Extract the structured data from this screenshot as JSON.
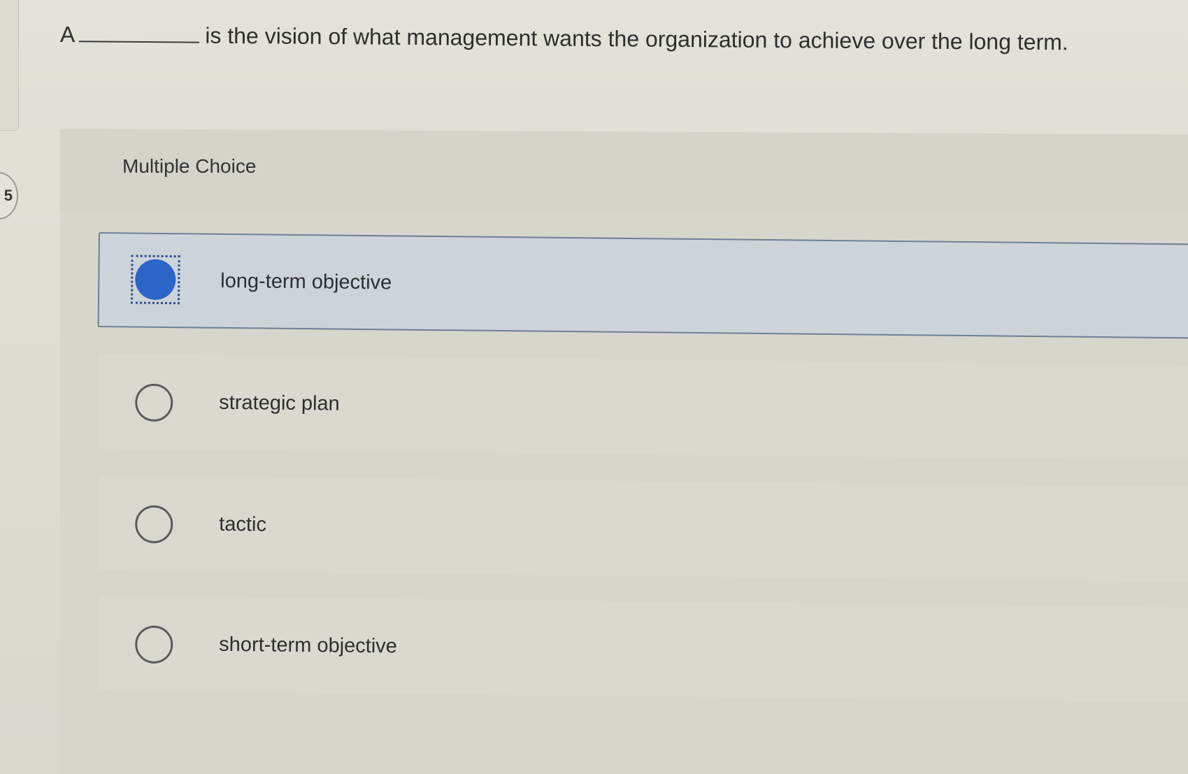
{
  "question": {
    "number": "5",
    "prefix": "A",
    "suffix": "is the vision of what management wants the organization to achieve over the long term."
  },
  "section_label": "Multiple Choice",
  "choices": [
    {
      "label": "long-term objective",
      "selected": true
    },
    {
      "label": "strategic plan",
      "selected": false
    },
    {
      "label": "tactic",
      "selected": false
    },
    {
      "label": "short-term objective",
      "selected": false
    }
  ],
  "colors": {
    "selected_radio": "#2d64c8",
    "selected_border": "#6e7f95",
    "background": "#dcdcd3"
  }
}
